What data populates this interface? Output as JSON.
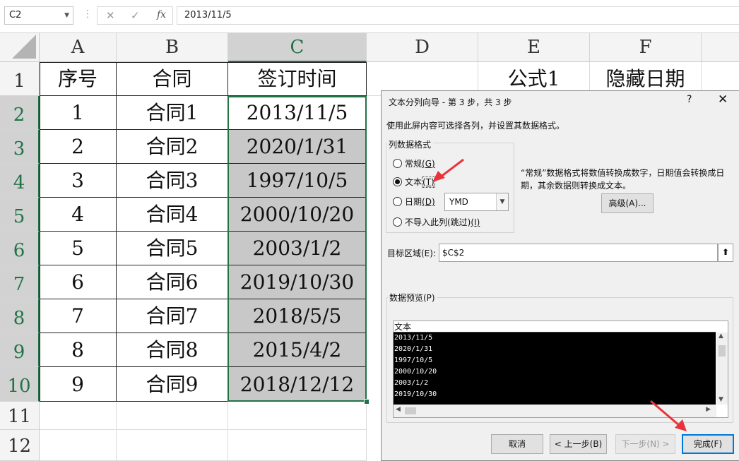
{
  "formula_bar": {
    "name_box": "C2",
    "cancel_icon": "✕",
    "enter_icon": "✓",
    "fx_label": "fx",
    "formula": "2013/11/5"
  },
  "sheet": {
    "columns": [
      "A",
      "B",
      "C",
      "D",
      "E",
      "F"
    ],
    "rows": [
      "1",
      "2",
      "3",
      "4",
      "5",
      "6",
      "7",
      "8",
      "9",
      "10",
      "11",
      "12"
    ],
    "header_row": {
      "A": "序号",
      "B": "合同",
      "C": "签订时间",
      "E": "公式1",
      "F": "隐藏日期"
    },
    "data": [
      {
        "A": "1",
        "B": "合同1",
        "C": "2013/11/5"
      },
      {
        "A": "2",
        "B": "合同2",
        "C": "2020/1/31"
      },
      {
        "A": "3",
        "B": "合同3",
        "C": "1997/10/5"
      },
      {
        "A": "4",
        "B": "合同4",
        "C": "2000/10/20"
      },
      {
        "A": "5",
        "B": "合同5",
        "C": "2003/1/2"
      },
      {
        "A": "6",
        "B": "合同6",
        "C": "2019/10/30"
      },
      {
        "A": "7",
        "B": "合同7",
        "C": "2018/5/5"
      },
      {
        "A": "8",
        "B": "合同8",
        "C": "2015/4/2"
      },
      {
        "A": "9",
        "B": "合同9",
        "C": "2018/12/12"
      }
    ],
    "selected_column": "C",
    "selection_color": "#217346"
  },
  "dialog": {
    "title": "文本分列向导 - 第 3 步，共 3 步",
    "help": "?",
    "close": "✕",
    "description": "使用此屏内容可选择各列，并设置其数据格式。",
    "format_group_label": "列数据格式",
    "formats": [
      {
        "label": "常规",
        "key": "(G)",
        "selected": false
      },
      {
        "label": "文本",
        "key": "(T)",
        "selected": true
      },
      {
        "label": "日期",
        "key": "(D)",
        "selected": false
      },
      {
        "label": "不导入此列(跳过)",
        "key": "(I)",
        "selected": false
      }
    ],
    "date_option": "YMD",
    "format_note": "“常规”数据格式将数值转换成数字，日期值会转换成日期，其余数据则转换成文本。",
    "advanced_button": "高级(A)...",
    "destination_label": "目标区域(E):",
    "destination_value": "$C$2",
    "preview_label": "数据预览(P)",
    "preview_header": "文本",
    "preview_rows": [
      "2013/11/5",
      "2020/1/31",
      "1997/10/5",
      "2000/10/20",
      "2003/1/2",
      "2019/10/30"
    ],
    "buttons": {
      "cancel": "取消",
      "back": "< 上一步(B)",
      "next": "下一步(N) >",
      "finish": "完成(F)"
    }
  },
  "annotation_color": "#e8333a"
}
